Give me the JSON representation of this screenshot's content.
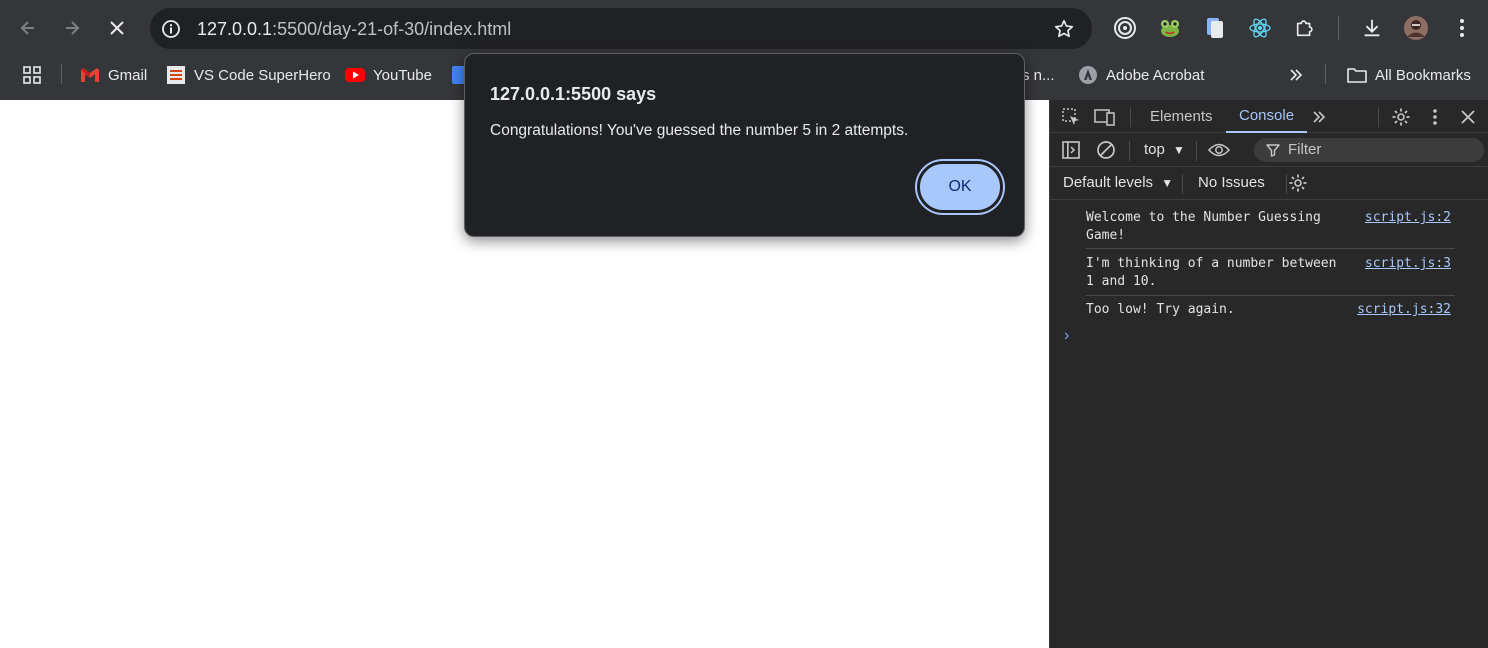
{
  "browser": {
    "url_host": "127.0.0.1",
    "url_rest": ":5500/day-21-of-30/index.html",
    "bookmarks": [
      {
        "label": "Gmail",
        "icon": "gmail-icon"
      },
      {
        "label": "VS Code SuperHero",
        "icon": "vscode-superhero-icon"
      },
      {
        "label": "YouTube",
        "icon": "youtube-icon"
      },
      {
        "label": "s n...",
        "icon": ""
      },
      {
        "label": "Adobe Acrobat",
        "icon": "adobe-acrobat-icon"
      }
    ],
    "all_bookmarks_label": "All Bookmarks"
  },
  "dialog": {
    "title": "127.0.0.1:5500 says",
    "message": "Congratulations! You've guessed the number 5 in 2 attempts.",
    "ok_label": "OK"
  },
  "devtools": {
    "tabs": [
      "Elements",
      "Console"
    ],
    "active_tab": "Console",
    "context": "top",
    "filter_placeholder": "Filter",
    "levels_label": "Default levels",
    "issues_label": "No Issues",
    "logs": [
      {
        "message": "Welcome to the Number Guessing Game!",
        "source": "script.js:2"
      },
      {
        "message": "I'm thinking of a number between 1 and 10.",
        "source": "script.js:3"
      },
      {
        "message": "Too low! Try again.",
        "source": "script.js:32"
      }
    ],
    "prompt_symbol": "›"
  },
  "colors": {
    "chrome_bg": "#35363a",
    "omnibox_bg": "#202124",
    "dialog_bg": "#202124",
    "accent": "#a8c7fa",
    "devtools_bg": "#282828"
  }
}
